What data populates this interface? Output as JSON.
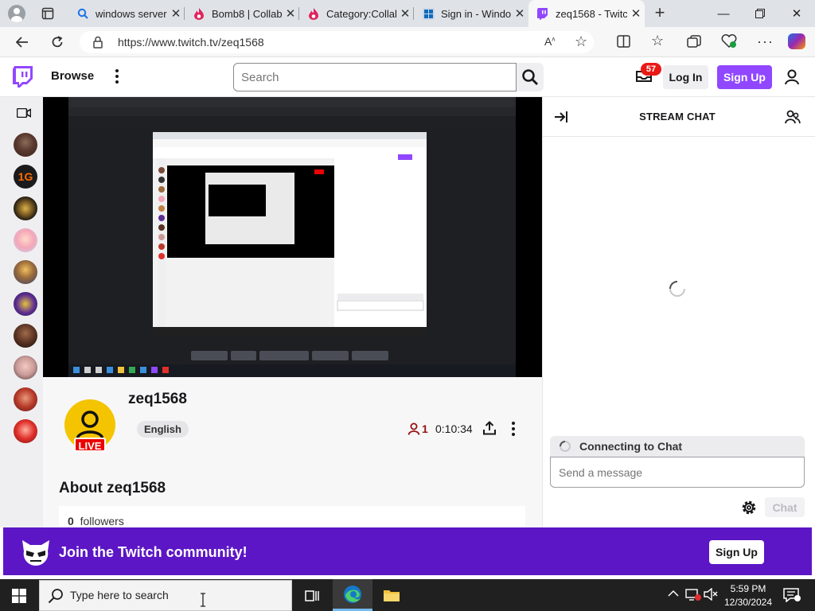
{
  "browser": {
    "tabs": [
      {
        "title": "windows server",
        "icon": "search-icon"
      },
      {
        "title": "Bomb8 | Collab",
        "icon": "fandom-icon"
      },
      {
        "title": "Category:Collab",
        "icon": "fandom-icon"
      },
      {
        "title": "Sign in - Windo",
        "icon": "windows-icon"
      },
      {
        "title": "zeq1568 - Twitc",
        "icon": "twitch-icon",
        "active": true
      }
    ],
    "url": "https://www.twitch.tv/zeq1568"
  },
  "topnav": {
    "browse_label": "Browse",
    "search_placeholder": "Search",
    "notification_count": "57",
    "login_label": "Log In",
    "signup_label": "Sign Up"
  },
  "channel": {
    "name": "zeq1568",
    "live_label": "LIVE",
    "language": "English",
    "viewers": "1",
    "uptime": "0:10:34",
    "about_title": "About zeq1568",
    "followers_count": "0",
    "followers_label": "followers"
  },
  "chat": {
    "title": "STREAM CHAT",
    "status": "Connecting to Chat",
    "input_placeholder": "Send a message",
    "send_label": "Chat"
  },
  "banner": {
    "text": "Join the Twitch community!",
    "button_label": "Sign Up"
  },
  "taskbar": {
    "search_placeholder": "Type here to search",
    "time": "5:59 PM",
    "date": "12/30/2024"
  },
  "colors": {
    "twitch_purple": "#9147ff",
    "banner_purple": "#5c16c5",
    "live_red": "#eb0400"
  }
}
